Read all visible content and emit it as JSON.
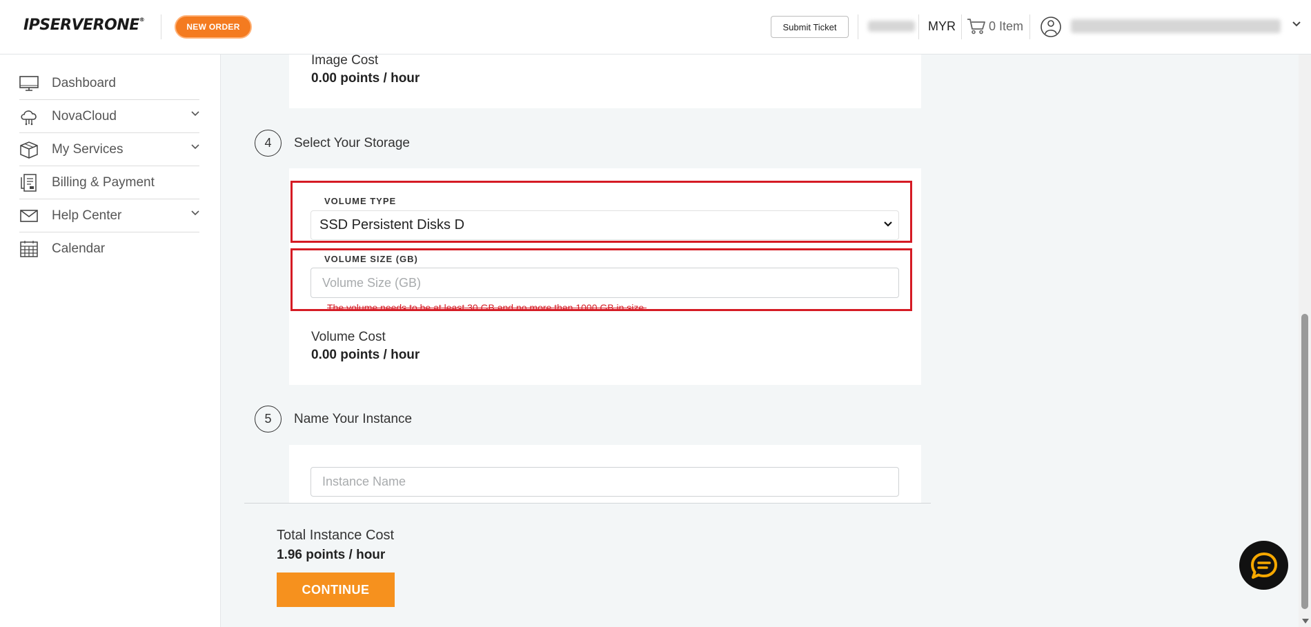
{
  "header": {
    "logo_text": "IPSERVERONE",
    "logo_mark": "®",
    "new_order_label": "NEW ORDER",
    "submit_ticket_label": "Submit Ticket",
    "currency": "MYR",
    "cart_label": "0 Item",
    "brand_color": "#f47b20"
  },
  "sidebar": {
    "items": [
      {
        "label": "Dashboard",
        "icon": "monitor-icon"
      },
      {
        "label": "NovaCloud",
        "icon": "cloud-icon"
      },
      {
        "label": "My Services",
        "icon": "box-icon"
      },
      {
        "label": "Billing & Payment",
        "icon": "invoice-icon"
      },
      {
        "label": "Help Center",
        "icon": "envelope-icon"
      },
      {
        "label": "Calendar",
        "icon": "calendar-icon"
      }
    ]
  },
  "image_section": {
    "cost_label": "Image Cost",
    "cost_value": "0.00 points / hour"
  },
  "storage_section": {
    "step_number": "4",
    "title": "Select Your Storage",
    "volume_type_label": "VOLUME TYPE",
    "volume_type_value": "SSD Persistent Disks D",
    "volume_size_label": "VOLUME SIZE (GB)",
    "volume_size_placeholder": "Volume Size (GB)",
    "volume_size_error": "The volume needs to be at least 30 GB and no more than 1000 GB in size.",
    "cost_label": "Volume Cost",
    "cost_value": "0.00 points / hour"
  },
  "name_section": {
    "step_number": "5",
    "title": "Name Your Instance",
    "instance_name_placeholder": "Instance Name"
  },
  "footer": {
    "total_label": "Total Instance Cost",
    "total_value": "1.96 points / hour",
    "continue_label": "CONTINUE"
  },
  "colors": {
    "highlight": "#d51b24",
    "continue": "#f6911e"
  }
}
